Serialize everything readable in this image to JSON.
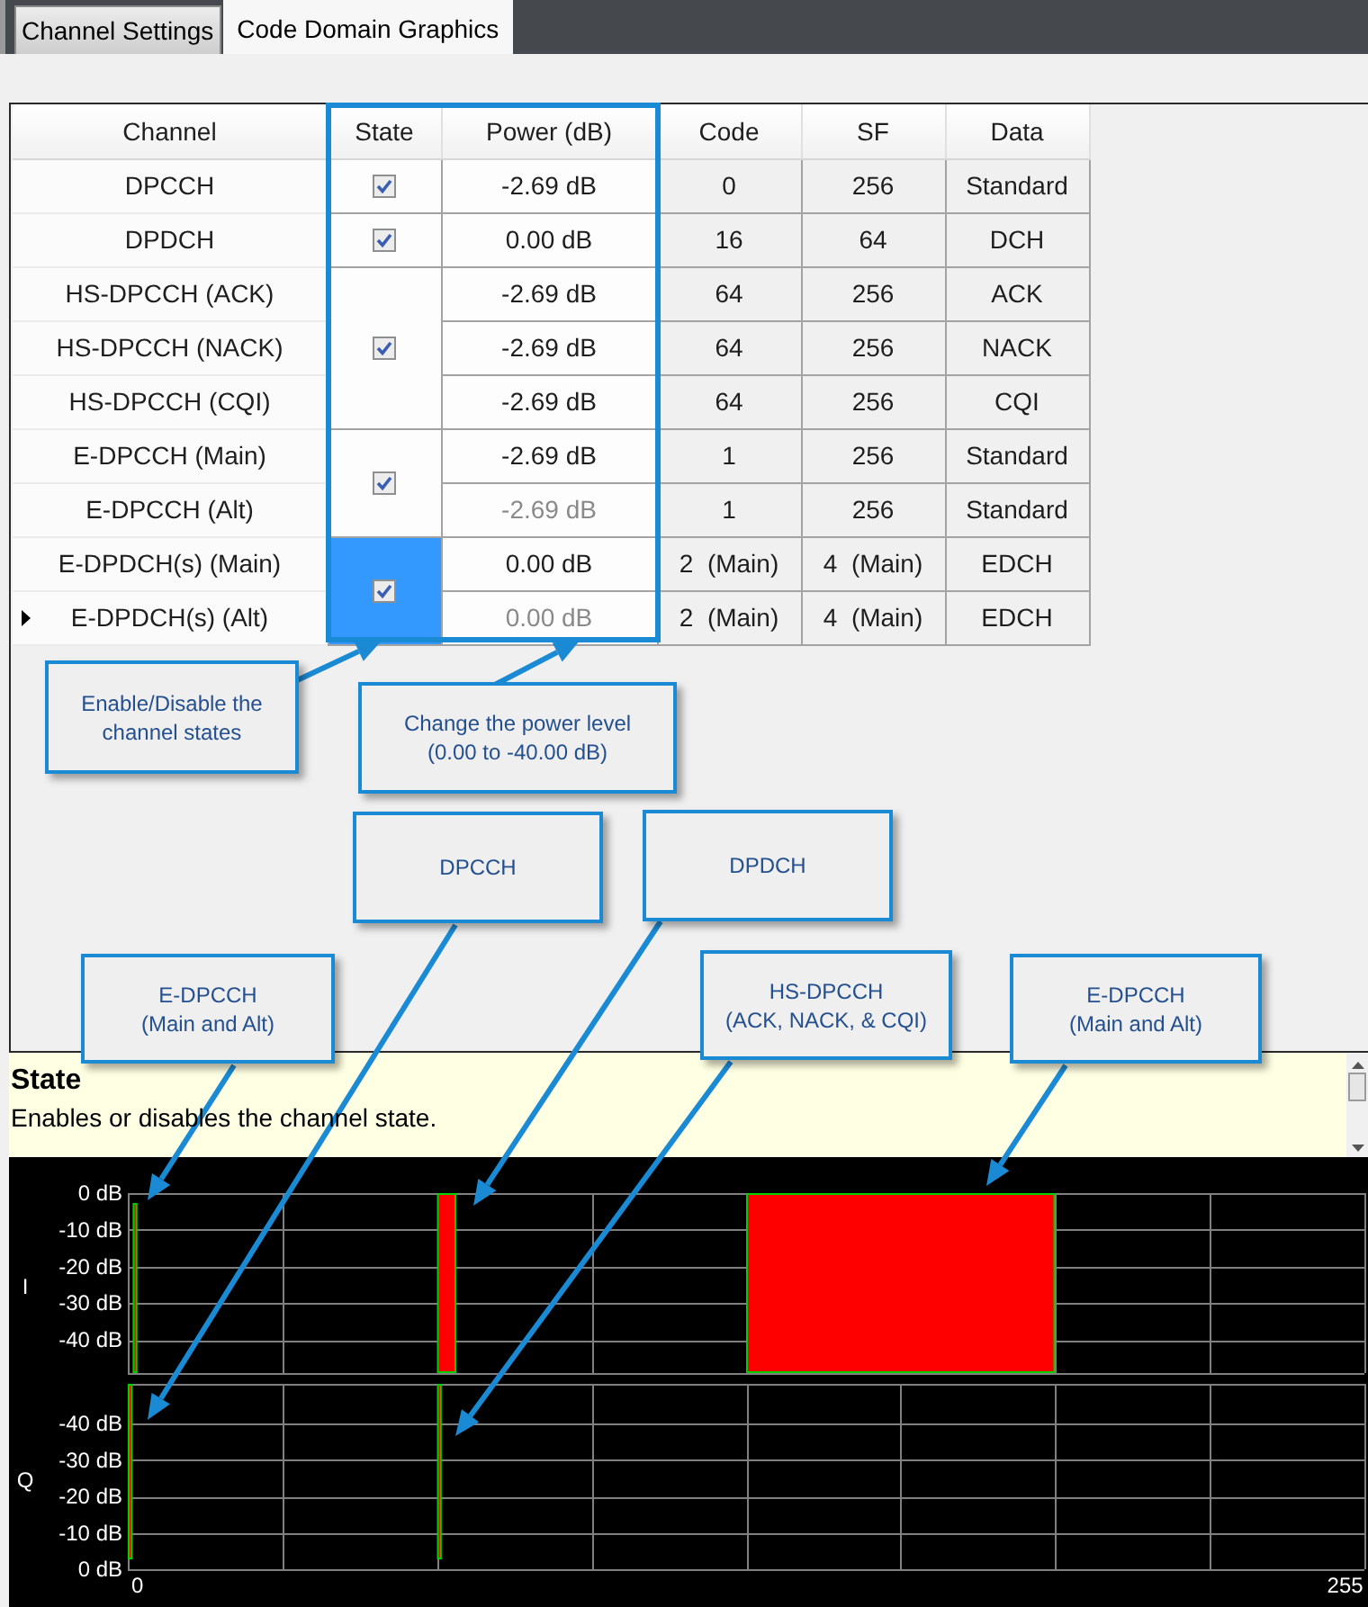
{
  "tabs": [
    {
      "label": "Channel Settings",
      "selected": false
    },
    {
      "label": "Code Domain Graphics",
      "selected": true
    }
  ],
  "table": {
    "columns": [
      "Channel",
      "State",
      "Power (dB)",
      "Code",
      "SF",
      "Data"
    ],
    "groups": [
      {
        "checked": true,
        "selected": false,
        "rows": [
          {
            "channel": "DPCCH",
            "power": "-2.69 dB",
            "disabled": false,
            "code": "0",
            "sf": "256",
            "data": "Standard",
            "current": false
          }
        ]
      },
      {
        "checked": true,
        "selected": false,
        "rows": [
          {
            "channel": "DPDCH",
            "power": "0.00 dB",
            "disabled": false,
            "code": "16",
            "sf": "64",
            "data": "DCH",
            "current": false
          }
        ]
      },
      {
        "checked": true,
        "selected": false,
        "rows": [
          {
            "channel": "HS-DPCCH (ACK)",
            "power": "-2.69 dB",
            "disabled": false,
            "code": "64",
            "sf": "256",
            "data": "ACK",
            "current": false
          },
          {
            "channel": "HS-DPCCH (NACK)",
            "power": "-2.69 dB",
            "disabled": false,
            "code": "64",
            "sf": "256",
            "data": "NACK",
            "current": false
          },
          {
            "channel": "HS-DPCCH (CQI)",
            "power": "-2.69 dB",
            "disabled": false,
            "code": "64",
            "sf": "256",
            "data": "CQI",
            "current": false
          }
        ]
      },
      {
        "checked": true,
        "selected": false,
        "rows": [
          {
            "channel": "E-DPCCH (Main)",
            "power": "-2.69 dB",
            "disabled": false,
            "code": "1",
            "sf": "256",
            "data": "Standard",
            "current": false
          },
          {
            "channel": "E-DPCCH (Alt)",
            "power": "-2.69 dB",
            "disabled": true,
            "code": "1",
            "sf": "256",
            "data": "Standard",
            "current": false
          }
        ]
      },
      {
        "checked": true,
        "selected": true,
        "rows": [
          {
            "channel": "E-DPDCH(s) (Main)",
            "power": "0.00 dB",
            "disabled": false,
            "code": "2  (Main)",
            "sf": "4  (Main)",
            "data": "EDCH",
            "current": false
          },
          {
            "channel": "E-DPDCH(s) (Alt)",
            "power": "0.00 dB",
            "disabled": true,
            "code": "2  (Main)",
            "sf": "4  (Main)",
            "data": "EDCH",
            "current": true
          }
        ]
      }
    ]
  },
  "callouts": [
    {
      "text": "Enable/Disable the\nchannel states"
    },
    {
      "text": "Change the power level\n(0.00 to -40.00 dB)"
    },
    {
      "text": "DPCCH"
    },
    {
      "text": "DPDCH"
    },
    {
      "text": "E-DPCCH\n(Main and Alt)"
    },
    {
      "text": "HS-DPCCH\n(ACK, NACK, & CQI)"
    },
    {
      "text": "E-DPCCH\n(Main and Alt)"
    }
  ],
  "help": {
    "title": "State",
    "text": "Enables or disables the channel state."
  },
  "charts": [
    {
      "axis_title": "I",
      "y_labels": [
        "0 dB",
        "-10 dB",
        "-20 dB",
        "-30 dB",
        "-40 dB"
      ]
    },
    {
      "axis_title": "Q",
      "y_labels": [
        "-40 dB",
        "-30 dB",
        "-20 dB",
        "-10 dB",
        "0 dB"
      ],
      "x_labels": [
        "0",
        "255"
      ]
    }
  ]
}
